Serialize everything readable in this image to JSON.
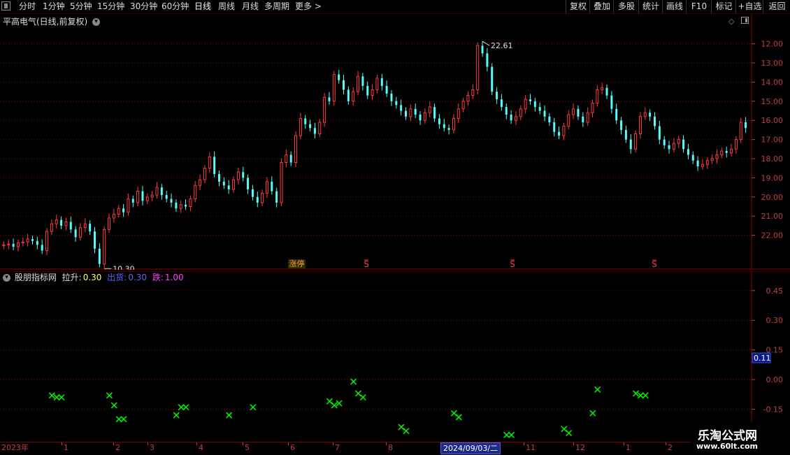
{
  "toolbar": {
    "timeframes": [
      "分时",
      "1分钟",
      "5分钟",
      "15分钟",
      "30分钟",
      "60分钟",
      "日线",
      "周线",
      "月线",
      "多周期",
      "更多 >"
    ],
    "active": "日线",
    "right_buttons": [
      "复权",
      "叠加",
      "多股",
      "统计",
      "画线",
      "F10",
      "标记",
      "+自选",
      "返回"
    ]
  },
  "main_panel": {
    "title": "平高电气(日线,前复权)",
    "high_label": "22.61",
    "low_label": "10.30",
    "marker_zhangting": "涨停",
    "marker_s": "S",
    "right_axis": [
      "22.00",
      "21.00",
      "20.00",
      "19.00",
      "18.00",
      "17.00",
      "16.00",
      "15.00",
      "14.00",
      "13.00",
      "12.00"
    ]
  },
  "indicator_panel": {
    "name": "股朋指标网",
    "lasheng_label": "拉升:",
    "lasheng_value": "0.30",
    "chuhuo_label": "出货:",
    "chuhuo_value": "0.30",
    "die_label": "跌:",
    "die_value": "1.00",
    "right_axis": [
      "0.45",
      "0.30",
      "0.15",
      "0.00",
      "-0.15"
    ],
    "current_value": "0.11"
  },
  "time_axis": {
    "labels": [
      "2023年",
      "1",
      "2",
      "3",
      "4",
      "5",
      "6",
      "7",
      "8",
      "11",
      "12",
      "1",
      "2"
    ],
    "cursor_date": "2024/09/03/二"
  },
  "watermark": {
    "line1": "乐淘公式网",
    "line2": "www.60lt.com"
  },
  "colors": {
    "up": "#ff3c3c",
    "down": "#54fcfc",
    "marker": "#00ee00",
    "grid": "#8a0000",
    "axis_red": "#c04040",
    "yellow": "#ffff60",
    "blue": "#6060ff",
    "magenta": "#ff40ff"
  },
  "chart_data": [
    {
      "type": "candlestick",
      "title": "平高电气(日线,前复权)",
      "ylim": [
        11.0,
        22.9
      ],
      "y_ticks": [
        12,
        13,
        14,
        15,
        16,
        17,
        18,
        19,
        20,
        21,
        22
      ],
      "close_series": [
        11.5,
        11.55,
        11.4,
        11.6,
        11.65,
        11.8,
        11.7,
        11.5,
        11.2,
        12.2,
        12.6,
        12.8,
        12.5,
        12.7,
        12.3,
        11.9,
        12.4,
        12.6,
        12.2,
        11.3,
        10.5,
        12.3,
        12.9,
        13.1,
        13.4,
        13.2,
        13.9,
        13.7,
        14.3,
        13.8,
        14.0,
        14.1,
        14.5,
        14.1,
        13.9,
        13.7,
        13.4,
        13.6,
        13.5,
        13.9,
        14.6,
        14.9,
        15.5,
        16.1,
        15.2,
        14.8,
        14.6,
        14.4,
        14.9,
        15.3,
        15.0,
        14.4,
        14.0,
        13.7,
        14.2,
        14.8,
        14.3,
        13.7,
        15.8,
        16.2,
        15.8,
        17.2,
        18.1,
        17.8,
        17.6,
        17.3,
        17.9,
        19.2,
        19.0,
        20.4,
        20.1,
        19.6,
        19.0,
        19.5,
        20.3,
        19.8,
        19.3,
        19.6,
        20.2,
        19.8,
        19.4,
        19.0,
        18.8,
        18.5,
        18.2,
        18.6,
        18.3,
        18.0,
        18.4,
        18.7,
        18.1,
        17.8,
        17.6,
        17.5,
        18.1,
        18.6,
        19.0,
        19.3,
        19.6,
        21.9,
        21.5,
        20.8,
        19.5,
        19.1,
        18.7,
        18.3,
        18.0,
        18.2,
        18.6,
        19.1,
        19.0,
        18.7,
        18.5,
        18.2,
        17.9,
        17.4,
        17.2,
        17.7,
        18.3,
        18.6,
        18.2,
        17.9,
        18.4,
        18.9,
        19.6,
        19.7,
        19.3,
        18.6,
        18.0,
        17.5,
        17.0,
        16.5,
        17.3,
        18.2,
        18.4,
        18.2,
        17.7,
        17.0,
        16.7,
        16.5,
        16.8,
        17.0,
        16.5,
        16.2,
        15.9,
        15.6,
        15.7,
        15.9,
        16.0,
        16.2,
        16.4,
        16.3,
        16.5,
        17.0,
        17.9,
        17.6
      ]
    },
    {
      "type": "scatter",
      "title": "股朋指标网",
      "ylim": [
        -0.3,
        0.52
      ],
      "y_ticks": [
        0.45,
        0.3,
        0.15,
        0.0,
        -0.15
      ],
      "x_index": [
        1,
        2,
        3,
        13,
        14,
        15,
        16,
        27,
        28,
        29,
        38,
        43,
        59,
        60,
        61,
        64,
        65,
        66,
        74,
        75,
        85,
        86,
        96,
        97,
        108,
        109,
        114,
        115,
        123,
        124,
        125
      ],
      "values": [
        -0.08,
        -0.09,
        -0.09,
        -0.08,
        -0.13,
        -0.2,
        -0.2,
        -0.18,
        -0.14,
        -0.14,
        -0.18,
        -0.14,
        -0.11,
        -0.13,
        -0.12,
        -0.01,
        -0.07,
        -0.09,
        -0.24,
        -0.26,
        -0.17,
        -0.19,
        -0.28,
        -0.28,
        -0.25,
        -0.27,
        -0.17,
        -0.05,
        -0.07,
        -0.08,
        -0.08
      ]
    }
  ]
}
